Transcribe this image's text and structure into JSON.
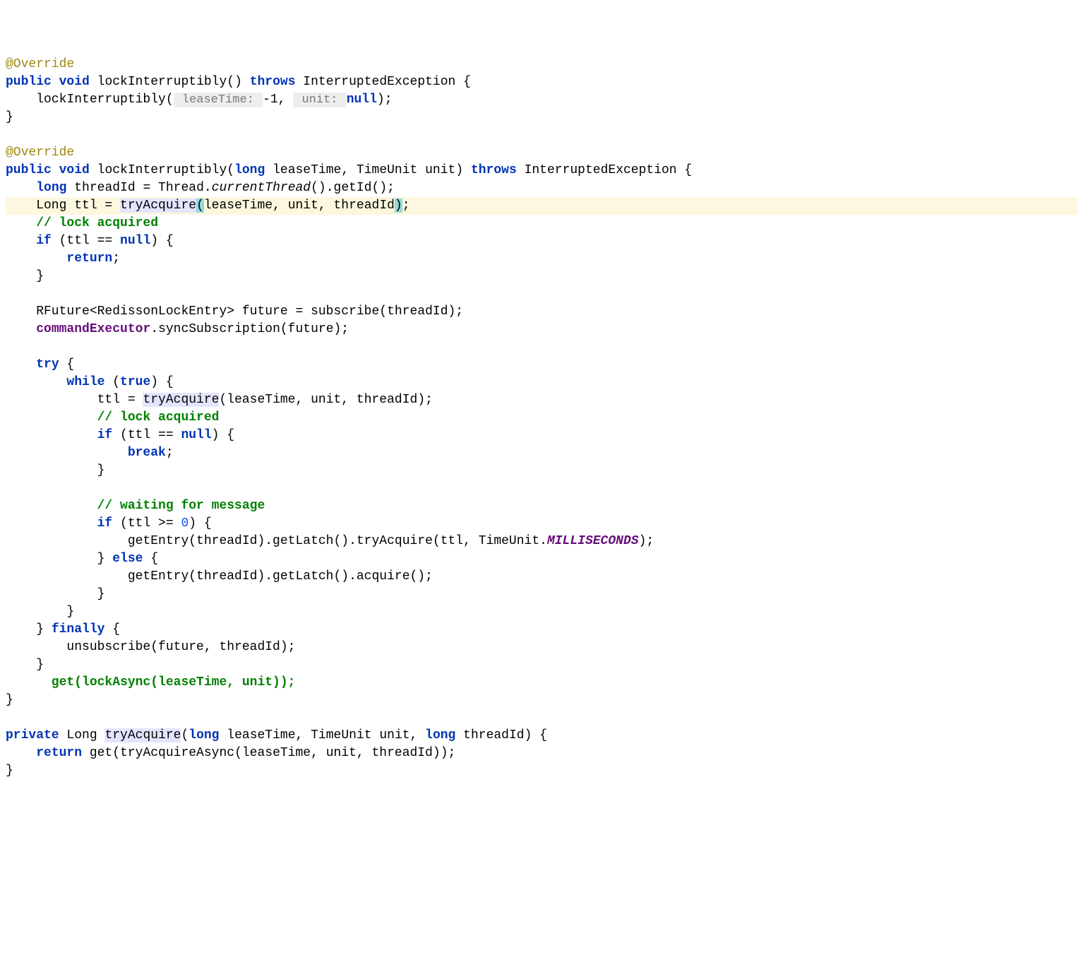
{
  "lines": {
    "l1_override": "@Override",
    "l2_public": "public",
    "l2_void": "void",
    "l2_method": " lockInterruptibly() ",
    "l2_throws": "throws",
    "l2_exception": " InterruptedException {",
    "l3_call": "    lockInterruptibly(",
    "l3_hint1": " leaseTime: ",
    "l3_arg1": "-1",
    "l3_mid": ", ",
    "l3_hint2": " unit: ",
    "l3_arg2": "null",
    "l3_end": ");",
    "l4": "}",
    "l6_override": "@Override",
    "l7_public": "public",
    "l7_void": "void",
    "l7_method": " lockInterruptibly(",
    "l7_long": "long",
    "l7_p1": " leaseTime, TimeUnit unit) ",
    "l7_throws": "throws",
    "l7_exc": " InterruptedException {",
    "l8_pre": "    ",
    "l8_long": "long",
    "l8_rest": " threadId = Thread.",
    "l8_ct": "currentThread",
    "l8_end": "().getId();",
    "l9_pre": "    Long ttl = ",
    "l9_tryacquire": "tryAcquire",
    "l9_lp": "(",
    "l9_args": "leaseTime, unit, threadId",
    "l9_rp": ")",
    "l9_end": ";",
    "l10": "    // lock acquired",
    "l11_pre": "    ",
    "l11_if": "if",
    "l11_mid": " (ttl == ",
    "l11_null": "null",
    "l11_end": ") {",
    "l12_pre": "        ",
    "l12_return": "return",
    "l12_end": ";",
    "l13": "    }",
    "l15": "    RFuture<RedissonLockEntry> future = subscribe(threadId);",
    "l16_pre": "    ",
    "l16_field": "commandExecutor",
    "l16_end": ".syncSubscription(future);",
    "l18_pre": "    ",
    "l18_try": "try",
    "l18_end": " {",
    "l19_pre": "        ",
    "l19_while": "while",
    "l19_mid": " (",
    "l19_true": "true",
    "l19_end": ") {",
    "l20_pre": "            ttl = ",
    "l20_tryacquire": "tryAcquire",
    "l20_end": "(leaseTime, unit, threadId);",
    "l21": "            // lock acquired",
    "l22_pre": "            ",
    "l22_if": "if",
    "l22_mid": " (ttl == ",
    "l22_null": "null",
    "l22_end": ") {",
    "l23_pre": "                ",
    "l23_break": "break",
    "l23_end": ";",
    "l24": "            }",
    "l26": "            // waiting for message",
    "l27_pre": "            ",
    "l27_if": "if",
    "l27_mid": " (ttl >= ",
    "l27_zero": "0",
    "l27_end": ") {",
    "l28_pre": "                getEntry(threadId).getLatch().tryAcquire(ttl, TimeUnit.",
    "l28_ms": "MILLISECONDS",
    "l28_end": ");",
    "l29_pre": "            } ",
    "l29_else": "else",
    "l29_end": " {",
    "l30": "                getEntry(threadId).getLatch().acquire();",
    "l31": "            }",
    "l32": "        }",
    "l33_pre": "    } ",
    "l33_finally": "finally",
    "l33_end": " {",
    "l34": "        unsubscribe(future, threadId);",
    "l35": "    }",
    "l36": "      get(lockAsync(leaseTime, unit));",
    "l37": "}",
    "l39_private": "private",
    "l39_rest1": " Long ",
    "l39_tryacquire": "tryAcquire",
    "l39_lp": "(",
    "l39_long": "long",
    "l39_p1": " leaseTime, TimeUnit unit, ",
    "l39_long2": "long",
    "l39_p2": " threadId) {",
    "l40_pre": "    ",
    "l40_return": "return",
    "l40_end": " get(tryAcquireAsync(leaseTime, unit, threadId));",
    "l41": "}"
  }
}
